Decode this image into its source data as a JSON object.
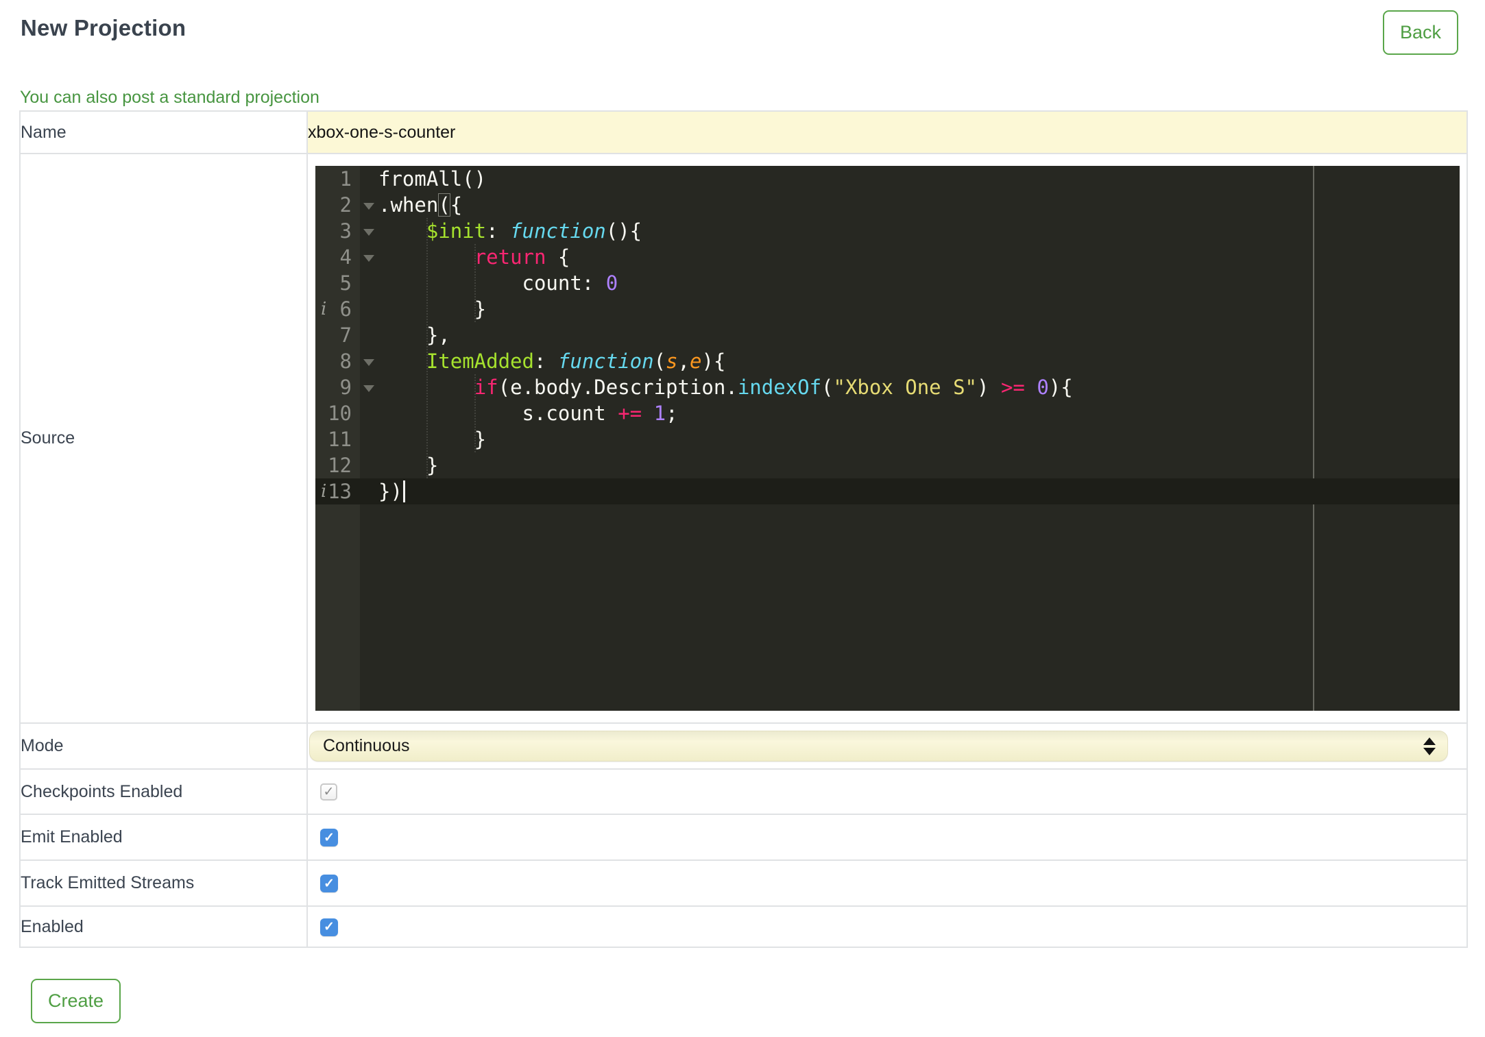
{
  "page": {
    "title": "New Projection"
  },
  "header": {
    "back_button": "Back"
  },
  "links": {
    "standard_projection": "You can also post a standard projection"
  },
  "form": {
    "name": {
      "label": "Name",
      "value": "xbox-one-s-counter"
    },
    "source": {
      "label": "Source"
    },
    "mode": {
      "label": "Mode",
      "selected": "Continuous"
    },
    "checkpoints_enabled": {
      "label": "Checkpoints Enabled",
      "checked": true,
      "disabled": true
    },
    "emit_enabled": {
      "label": "Emit Enabled",
      "checked": true,
      "disabled": false
    },
    "track_emitted_streams": {
      "label": "Track Emitted Streams",
      "checked": true,
      "disabled": false
    },
    "enabled": {
      "label": "Enabled",
      "checked": true,
      "disabled": false
    }
  },
  "actions": {
    "create_button": "Create"
  },
  "ui_colors": {
    "accent_green": "#4f9e43",
    "heading": "#3a434e",
    "input_highlight": "#fcf8d6",
    "checkbox_blue": "#478ee0",
    "table_border": "#e0e2e4"
  },
  "editor": {
    "language": "javascript",
    "theme": "monokai-dark",
    "active_line": 13,
    "annotations": {
      "info_lines": [
        6,
        13
      ]
    },
    "fold_lines": [
      2,
      3,
      4,
      8,
      9
    ],
    "colors": {
      "background": "#272822",
      "gutter": "#30312a",
      "active_line": "#1d1e18",
      "text": "#f8f8f2",
      "keyword": "#f92672",
      "entity": "#a6e22e",
      "storage": "#66d9ef",
      "string": "#e6db74",
      "number": "#ae81ff",
      "parameter": "#fd971f",
      "line_number": "#8f908a",
      "print_margin": "#66675f"
    },
    "source_text": "fromAll()\n.when({\n    $init: function(){\n        return {\n            count: 0\n        }\n    },\n    ItemAdded: function(s,e){\n        if(e.body.Description.indexOf(\"Xbox One S\") >= 0){\n            s.count += 1;\n        }\n    }\n})",
    "lines": [
      {
        "n": 1,
        "tokens": [
          [
            "p",
            "fromAll()"
          ]
        ]
      },
      {
        "n": 2,
        "fold": true,
        "tokens": [
          [
            "p",
            ".when"
          ],
          [
            "bm",
            "("
          ],
          [
            "p",
            "{"
          ]
        ]
      },
      {
        "n": 3,
        "fold": true,
        "tokens": [
          [
            "p",
            "    "
          ],
          [
            "fn",
            "$init"
          ],
          [
            "p",
            ": "
          ],
          [
            "st",
            "function"
          ],
          [
            "p",
            "(){"
          ]
        ]
      },
      {
        "n": 4,
        "fold": true,
        "tokens": [
          [
            "p",
            "        "
          ],
          [
            "kw",
            "return"
          ],
          [
            "p",
            " {"
          ]
        ]
      },
      {
        "n": 5,
        "tokens": [
          [
            "p",
            "            count: "
          ],
          [
            "num",
            "0"
          ]
        ]
      },
      {
        "n": 6,
        "info": true,
        "tokens": [
          [
            "p",
            "        }"
          ]
        ]
      },
      {
        "n": 7,
        "tokens": [
          [
            "p",
            "    },"
          ]
        ]
      },
      {
        "n": 8,
        "fold": true,
        "tokens": [
          [
            "p",
            "    "
          ],
          [
            "fn",
            "ItemAdded"
          ],
          [
            "p",
            ": "
          ],
          [
            "st",
            "function"
          ],
          [
            "p",
            "("
          ],
          [
            "pa",
            "s"
          ],
          [
            "p",
            ","
          ],
          [
            "pa",
            "e"
          ],
          [
            "p",
            "){"
          ]
        ]
      },
      {
        "n": 9,
        "fold": true,
        "tokens": [
          [
            "p",
            "        "
          ],
          [
            "kw",
            "if"
          ],
          [
            "p",
            "(e.body.Description."
          ],
          [
            "sf",
            "indexOf"
          ],
          [
            "p",
            "("
          ],
          [
            "str",
            "\"Xbox One S\""
          ],
          [
            "p",
            ") "
          ],
          [
            "kw",
            ">="
          ],
          [
            "p",
            " "
          ],
          [
            "num",
            "0"
          ],
          [
            "p",
            "){"
          ]
        ]
      },
      {
        "n": 10,
        "tokens": [
          [
            "p",
            "            s.count "
          ],
          [
            "kw",
            "+="
          ],
          [
            "p",
            " "
          ],
          [
            "num",
            "1"
          ],
          [
            "p",
            ";"
          ]
        ]
      },
      {
        "n": 11,
        "tokens": [
          [
            "p",
            "        }"
          ]
        ]
      },
      {
        "n": 12,
        "tokens": [
          [
            "p",
            "    }"
          ]
        ]
      },
      {
        "n": 13,
        "info": true,
        "active": true,
        "cursor": true,
        "tokens": [
          [
            "p",
            "})"
          ]
        ]
      }
    ]
  }
}
